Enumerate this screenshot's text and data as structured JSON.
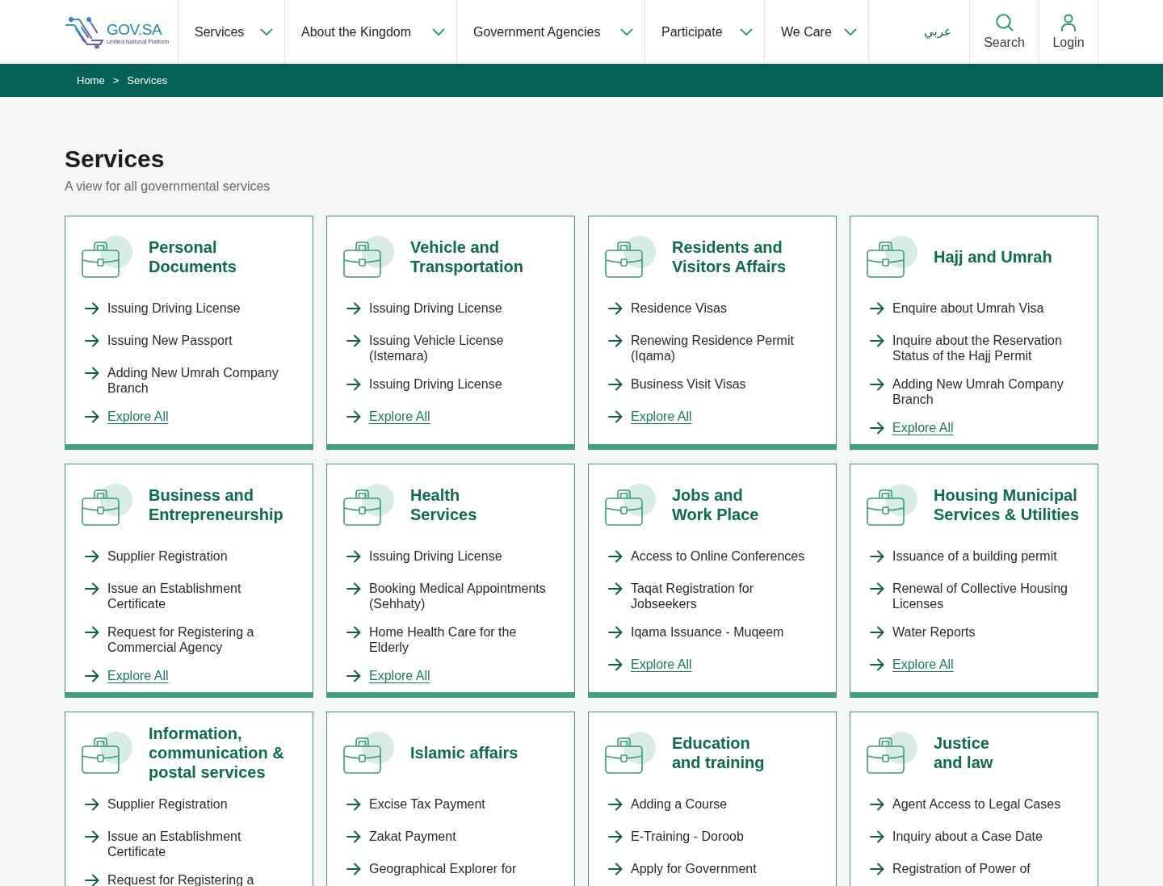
{
  "header": {
    "logo": {
      "wordmark": "GOV.SA",
      "tagline": "Unified National Platform"
    },
    "nav": [
      "Services",
      "About the Kingdom",
      "Government Agencies",
      "Participate",
      "We Care"
    ],
    "language": "عربي",
    "actions": [
      {
        "kind": "search",
        "label": "Search"
      },
      {
        "kind": "login",
        "label": "Login"
      }
    ]
  },
  "breadcrumb": {
    "items": [
      "Home",
      "Services"
    ],
    "separator": ">"
  },
  "page": {
    "title": "Services",
    "subtitle": "A view for all governmental services"
  },
  "categories": [
    {
      "title": "Personal\nDocuments",
      "services": [
        "Issuing Driving License",
        "Issuing New Passport",
        "Adding New Umrah Company\nBranch"
      ],
      "link": "Explore All"
    },
    {
      "title": "Vehicle and\nTransportation",
      "services": [
        "Issuing Driving License",
        "Issuing Vehicle License\n(Istemara)",
        "Issuing Driving License"
      ],
      "link": "Explore All"
    },
    {
      "title": "Residents and\nVisitors Affairs",
      "services": [
        "Residence Visas",
        "Renewing Residence Permit\n(Iqama)",
        "Business Visit Visas"
      ],
      "link": "Explore All"
    },
    {
      "title": "Hajj and Umrah",
      "services": [
        "Enquire about Umrah Visa",
        "Inquire about the Reservation\nStatus of the Hajj Permit",
        "Adding New Umrah Company\nBranch"
      ],
      "link": "Explore All"
    },
    {
      "title": "Business and\nEntrepreneurship",
      "services": [
        "Supplier Registration",
        "Issue an Establishment\nCertificate",
        "Request for Registering a\nCommercial Agency"
      ],
      "link": "Explore All"
    },
    {
      "title": "Health\nServices",
      "services": [
        "Issuing Driving License",
        "Booking Medical Appointments\n(Sehhaty)",
        "Home Health Care for the\nElderly"
      ],
      "link": "Explore All"
    },
    {
      "title": "Jobs and\nWork Place",
      "services": [
        "Access to Online Conferences",
        "Taqat Registration for\nJobseekers",
        "Iqama Issuance - Muqeem"
      ],
      "link": "Explore All"
    },
    {
      "title": "Housing Municipal\nServices & Utilities",
      "services": [
        "Issuance of a building permit",
        "Renewal of Collective Housing\nLicenses",
        "Water Reports"
      ],
      "link": "Explore All"
    },
    {
      "title": "Information,\ncommunication &\npostal services",
      "services": [
        "Supplier Registration",
        "Issue an Establishment\nCertificate",
        "Request for Registering a"
      ]
    },
    {
      "title": "Islamic affairs",
      "services": [
        "Excise Tax Payment",
        "Zakat Payment",
        "Geographical Explorer for"
      ]
    },
    {
      "title": "Education\nand training",
      "services": [
        "Adding a Course",
        "E-Training - Doroob",
        "Apply for Government"
      ]
    },
    {
      "title": "Justice\nand law",
      "services": [
        "Agent Access to Legal Cases",
        "Inquiry about a Case Date",
        "Registration of Power of"
      ]
    }
  ]
}
